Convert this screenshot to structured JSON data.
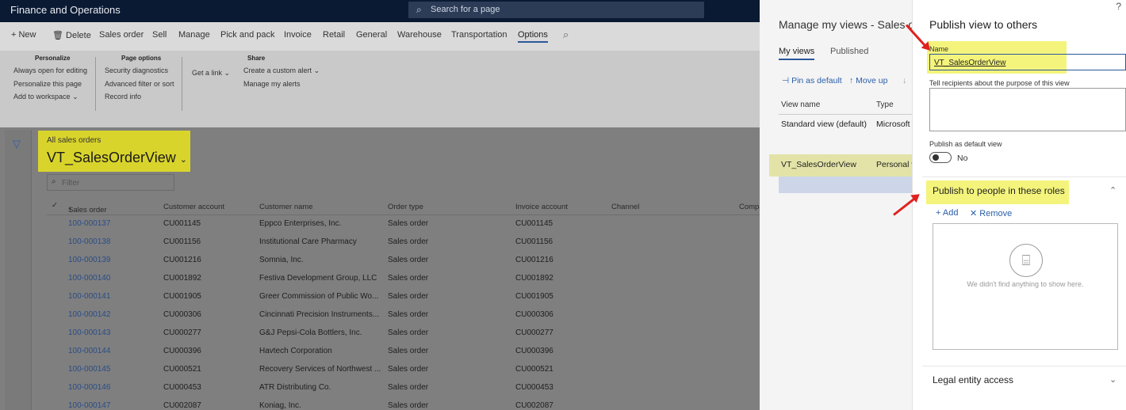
{
  "app": {
    "title": "Finance and Operations",
    "search_placeholder": "Search for a page"
  },
  "action_pane": {
    "tabs": [
      "New",
      "Delete",
      "Sales order",
      "Sell",
      "Manage",
      "Pick and pack",
      "Invoice",
      "Retail",
      "General",
      "Warehouse",
      "Transportation",
      "Options"
    ],
    "active_tab": "Options"
  },
  "ribbon": {
    "personalize": {
      "header": "Personalize",
      "items": [
        "Always open for editing",
        "Personalize this page",
        "Add to workspace"
      ]
    },
    "page_options": {
      "header": "Page options",
      "items": [
        "Security diagnostics",
        "Advanced filter or sort",
        "Record info"
      ]
    },
    "get_link": "Get a link",
    "share": {
      "header": "Share",
      "items": [
        "Create a custom alert",
        "Manage my alerts"
      ]
    }
  },
  "view": {
    "subtitle": "All sales orders",
    "name": "VT_SalesOrderView",
    "filter_placeholder": "Filter"
  },
  "grid": {
    "columns": [
      "Sales order",
      "Customer account",
      "Customer name",
      "Order type",
      "Invoice account",
      "Channel",
      "Compa"
    ],
    "rows": [
      [
        "100-000137",
        "CU001145",
        "Eppco Enterprises, Inc.",
        "Sales order",
        "CU001145"
      ],
      [
        "100-000138",
        "CU001156",
        "Institutional Care Pharmacy",
        "Sales order",
        "CU001156"
      ],
      [
        "100-000139",
        "CU001216",
        "Somnia, Inc.",
        "Sales order",
        "CU001216"
      ],
      [
        "100-000140",
        "CU001892",
        "Festiva Development Group, LLC",
        "Sales order",
        "CU001892"
      ],
      [
        "100-000141",
        "CU001905",
        "Greer Commission of Public Wo...",
        "Sales order",
        "CU001905"
      ],
      [
        "100-000142",
        "CU000306",
        "Cincinnati Precision Instruments...",
        "Sales order",
        "CU000306"
      ],
      [
        "100-000143",
        "CU000277",
        "G&J Pepsi-Cola Bottlers, Inc.",
        "Sales order",
        "CU000277"
      ],
      [
        "100-000144",
        "CU000396",
        "Havtech Corporation",
        "Sales order",
        "CU000396"
      ],
      [
        "100-000145",
        "CU000521",
        "Recovery Services of Northwest ...",
        "Sales order",
        "CU000521"
      ],
      [
        "100-000146",
        "CU000453",
        "ATR Distributing Co.",
        "Sales order",
        "CU000453"
      ],
      [
        "100-000147",
        "CU002087",
        "Koniag, Inc.",
        "Sales order",
        "CU002087"
      ]
    ]
  },
  "manage_views": {
    "title": "Manage my views - Sales or",
    "tabs": [
      "My views",
      "Published"
    ],
    "actions": [
      "Pin as default",
      "Move up",
      "↓"
    ],
    "columns": [
      "View name",
      "Type"
    ],
    "rows": [
      [
        "Standard view (default)",
        "Microsoft"
      ],
      [
        "VT_SalesOrderView",
        "Personal v"
      ]
    ]
  },
  "publish": {
    "title": "Publish view to others",
    "name_label": "Name",
    "name_value": "VT_SalesOrderView",
    "purpose_label": "Tell recipients about the purpose of this view",
    "default_label": "Publish as default view",
    "default_value": "No",
    "roles_title": "Publish to people in these roles",
    "add_label": "Add",
    "remove_label": "Remove",
    "empty_text": "We didn't find anything to show here.",
    "legal_title": "Legal entity access"
  },
  "colors": {
    "accent": "#2b579a",
    "highlight": "#f4f47c",
    "topbar": "#0b1a33",
    "arrow": "#e0211f"
  }
}
